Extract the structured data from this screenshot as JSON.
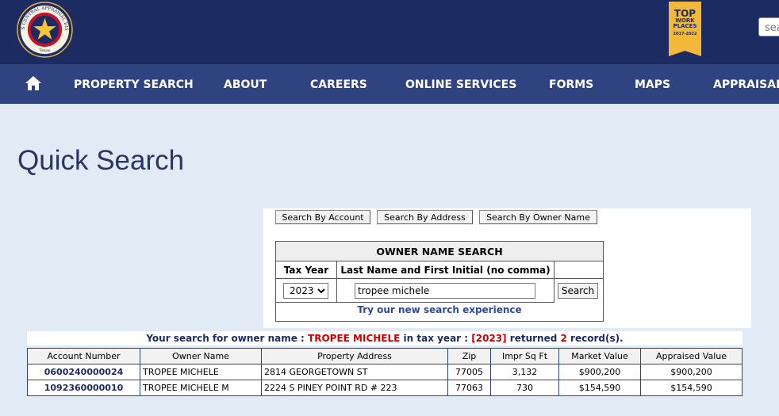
{
  "header": {
    "logo": {
      "top_text": "HARRIS CENTRAL APPRAISAL DISTRICT",
      "bottom_text": "Texas"
    },
    "badge": {
      "line1": "TOP",
      "line2": "WORK",
      "line3": "PLACES",
      "years": "2017-2022"
    },
    "search": {
      "placeholder": "sea"
    }
  },
  "nav": {
    "items": [
      {
        "label": "PROPERTY SEARCH"
      },
      {
        "label": "ABOUT"
      },
      {
        "label": "CAREERS"
      },
      {
        "label": "ONLINE SERVICES"
      },
      {
        "label": "FORMS"
      },
      {
        "label": "MAPS"
      },
      {
        "label": "APPRAISAL"
      }
    ]
  },
  "page": {
    "title": "Quick Search"
  },
  "search_tabs": {
    "by_account": "Search By Account",
    "by_address": "Search By Address",
    "by_owner": "Search By Owner Name"
  },
  "owner_search": {
    "title": "OWNER NAME SEARCH",
    "col_year": "Tax Year",
    "col_name": "Last Name and First Initial (no comma)",
    "year_value": "2023",
    "name_value": "tropee michele",
    "search_button": "Search",
    "new_experience_link": "Try our new search experience"
  },
  "result_summary": {
    "prefix": "Your search for owner name : ",
    "owner": "TROPEE MICHELE",
    "middle": " in tax year : ",
    "year": "[2023]",
    "returned": " returned ",
    "count": "2",
    "suffix": " record(s)."
  },
  "results": {
    "columns": [
      "Account Number",
      "Owner Name",
      "Property Address",
      "Zip",
      "Impr Sq Ft",
      "Market Value",
      "Appraised Value"
    ],
    "rows": [
      [
        "0600240000024",
        "TROPEE MICHELE",
        "2814 GEORGETOWN ST",
        "77005",
        "3,132",
        "$900,200",
        "$900,200"
      ],
      [
        "1092360000010",
        "TROPEE MICHELE M",
        "2224 S PINEY POINT RD # 223",
        "77063",
        "730",
        "$154,590",
        "$154,590"
      ]
    ]
  },
  "colors": {
    "header_bg": "#1c2c63",
    "nav_bg": "#2f4381",
    "page_bg": "#e2eaf5",
    "accent": "#f3b73a",
    "alert": "#cc0000"
  }
}
